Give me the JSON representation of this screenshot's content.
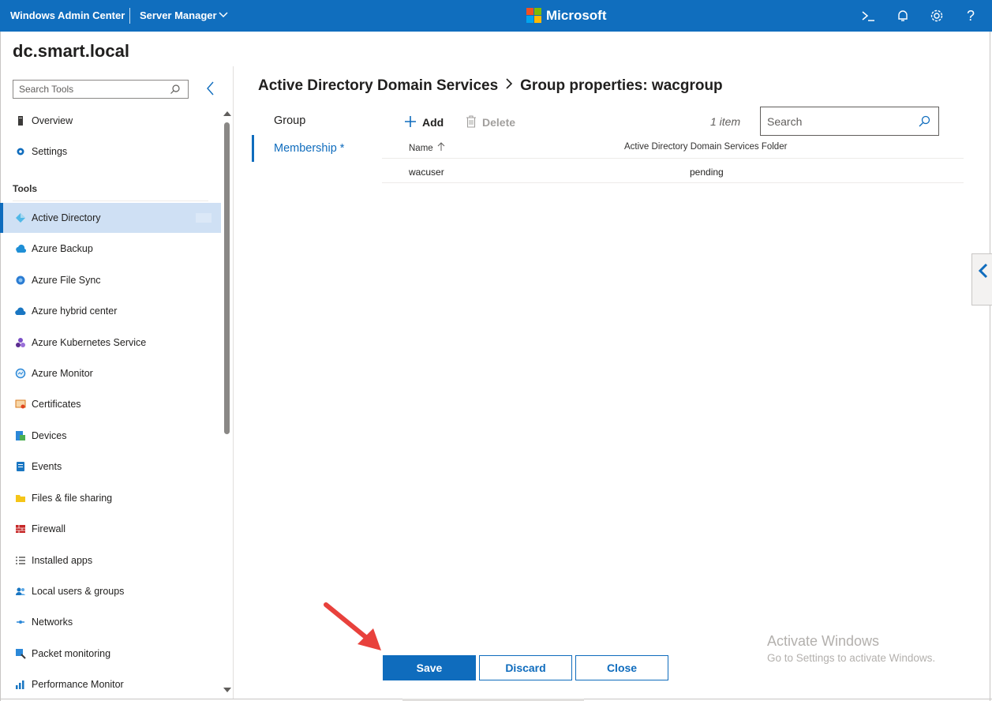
{
  "topbar": {
    "app_title": "Windows Admin Center",
    "server_manager": "Server Manager",
    "brand": "Microsoft",
    "icons": [
      "powershell-icon",
      "notifications-icon",
      "settings-icon",
      "help-icon"
    ],
    "help_glyph": "?"
  },
  "server": {
    "name": "dc.smart.local"
  },
  "sidebar": {
    "search_placeholder": "Search Tools",
    "top_items": [
      {
        "label": "Overview",
        "icon": "overview-icon"
      },
      {
        "label": "Settings",
        "icon": "gear-icon"
      }
    ],
    "tools_heading": "Tools",
    "items": [
      {
        "label": "Active Directory",
        "icon": "active-directory-icon",
        "active": true
      },
      {
        "label": "Azure Backup",
        "icon": "azure-backup-icon"
      },
      {
        "label": "Azure File Sync",
        "icon": "azure-file-sync-icon"
      },
      {
        "label": "Azure hybrid center",
        "icon": "azure-hybrid-center-icon"
      },
      {
        "label": "Azure Kubernetes Service",
        "icon": "azure-kubernetes-icon"
      },
      {
        "label": "Azure Monitor",
        "icon": "azure-monitor-icon"
      },
      {
        "label": "Certificates",
        "icon": "certificates-icon"
      },
      {
        "label": "Devices",
        "icon": "devices-icon"
      },
      {
        "label": "Events",
        "icon": "events-icon"
      },
      {
        "label": "Files & file sharing",
        "icon": "folder-icon"
      },
      {
        "label": "Firewall",
        "icon": "firewall-icon"
      },
      {
        "label": "Installed apps",
        "icon": "installed-apps-icon"
      },
      {
        "label": "Local users & groups",
        "icon": "users-icon"
      },
      {
        "label": "Networks",
        "icon": "networks-icon"
      },
      {
        "label": "Packet monitoring",
        "icon": "packet-monitoring-icon"
      },
      {
        "label": "Performance Monitor",
        "icon": "performance-monitor-icon"
      }
    ]
  },
  "breadcrumb": {
    "parent": "Active Directory Domain Services",
    "current": "Group properties: wacgroup"
  },
  "tabs": {
    "group": "Group",
    "membership": "Membership *"
  },
  "toolbar": {
    "add_label": "Add",
    "delete_label": "Delete",
    "item_count": "1 item",
    "search_placeholder": "Search"
  },
  "grid": {
    "columns": [
      "Name",
      "Active Directory Domain Services Folder"
    ],
    "rows": [
      {
        "name": "wacuser",
        "folder": "pending"
      }
    ]
  },
  "actions": {
    "save": "Save",
    "discard": "Discard",
    "close": "Close"
  },
  "watermark": {
    "line1": "Activate Windows",
    "line2": "Go to Settings to activate Windows."
  },
  "colors": {
    "accent": "#0f6cbd",
    "active_nav_bg": "#cfe0f4",
    "annotation_arrow": "#e8413c"
  }
}
